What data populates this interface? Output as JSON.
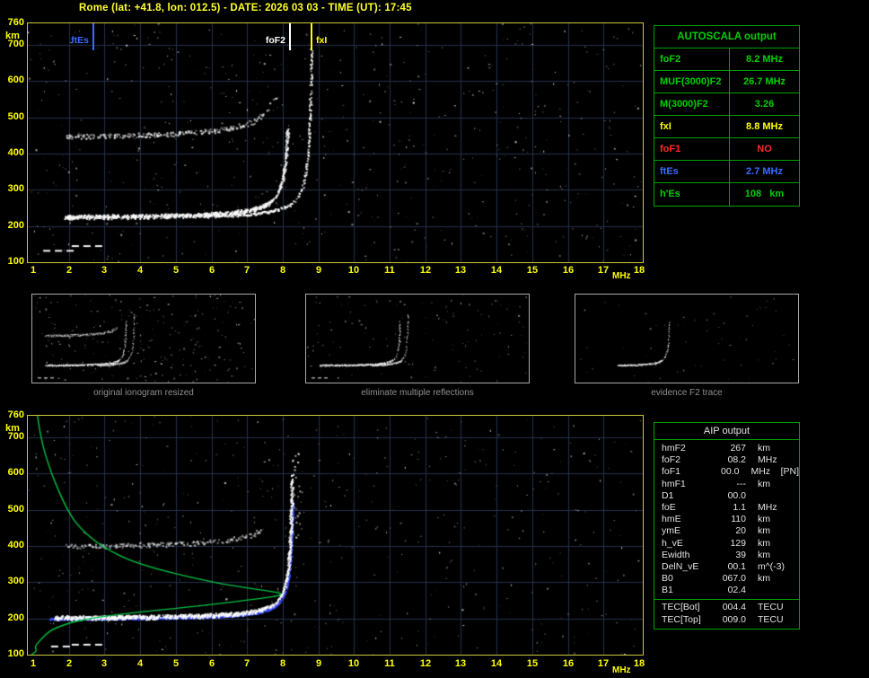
{
  "header": {
    "title": "Rome (lat: +41.8, lon: 012.5) - DATE: 2026 03 03 - TIME (UT): 17:45"
  },
  "colors": {
    "axis_yellow": "#ffff00",
    "plot_border": "#c9c93a",
    "grid": "#26304a",
    "table_green": "#00d000",
    "table_border": "#00a000",
    "red": "#ff2828",
    "blue": "#3a6bff",
    "yellow": "#ffff00",
    "white": "#ffffff",
    "aip_text": "#e2e2e2",
    "caption_gray": "#8f8f8f",
    "profile_green": "#00c244",
    "trace_blue": "#3d4fff"
  },
  "axes": {
    "x_unit": "MHz",
    "y_unit": "km",
    "x_ticks": [
      1,
      2,
      3,
      4,
      5,
      6,
      7,
      8,
      9,
      10,
      11,
      12,
      13,
      14,
      15,
      16,
      17,
      18
    ],
    "y_ticks": [
      760,
      700,
      600,
      500,
      400,
      300,
      200,
      100
    ]
  },
  "top_plot": {
    "markers": [
      {
        "label": "ftEs",
        "freq": 2.7,
        "color": "blue"
      },
      {
        "label": "foF2",
        "freq": 8.2,
        "color": "white"
      },
      {
        "label": "fxI",
        "freq": 8.8,
        "color": "yellow"
      }
    ]
  },
  "autoscala": {
    "title": "AUTOSCALA output",
    "rows": [
      {
        "param": "foF2",
        "value": "8.2 MHz",
        "color": "green"
      },
      {
        "param": "MUF(3000)F2",
        "value": "26.7 MHz",
        "color": "green"
      },
      {
        "param": "M(3000)F2",
        "value": "3.26",
        "color": "green"
      },
      {
        "param": "fxI",
        "value": "8.8 MHz",
        "color": "yellow"
      },
      {
        "param": "foF1",
        "value": "NO",
        "color": "red"
      },
      {
        "param": "ftEs",
        "value": "2.7 MHz",
        "color": "blue"
      },
      {
        "param": "h'Es",
        "value": "108   km",
        "color": "green"
      }
    ]
  },
  "thumbnails": [
    {
      "caption": "original ionogram resized"
    },
    {
      "caption": "eliminate multiple reflections"
    },
    {
      "caption": "evidence F2 trace"
    }
  ],
  "aip": {
    "title": "AIP output",
    "rows": [
      {
        "param": "hmF2",
        "value": "267",
        "unit": "km",
        "note": ""
      },
      {
        "param": "foF2",
        "value": "08.2",
        "unit": "MHz",
        "note": ""
      },
      {
        "param": "foF1",
        "value": "00.0",
        "unit": "MHz",
        "note": "[PN]"
      },
      {
        "param": "hmF1",
        "value": "---",
        "unit": "km",
        "note": ""
      },
      {
        "param": "D1",
        "value": "00.0",
        "unit": "",
        "note": ""
      },
      {
        "param": "foE",
        "value": "1.1",
        "unit": "MHz",
        "note": ""
      },
      {
        "param": "hmE",
        "value": "110",
        "unit": "km",
        "note": ""
      },
      {
        "param": "ymE",
        "value": "20",
        "unit": "km",
        "note": ""
      },
      {
        "param": "h_vE",
        "value": "129",
        "unit": "km",
        "note": ""
      },
      {
        "param": "Ewidth",
        "value": "39",
        "unit": "km",
        "note": ""
      },
      {
        "param": "DelN_vE",
        "value": "00.1",
        "unit": "m^(-3)",
        "note": ""
      },
      {
        "param": "B0",
        "value": "067.0",
        "unit": "km",
        "note": ""
      },
      {
        "param": "B1",
        "value": "02.4",
        "unit": "",
        "note": ""
      }
    ],
    "tec_rows": [
      {
        "param": "TEC[Bot]",
        "value": "004.4",
        "unit": "TECU",
        "note": ""
      },
      {
        "param": "TEC[Top]",
        "value": "009.0",
        "unit": "TECU",
        "note": ""
      }
    ]
  },
  "chart_data": [
    {
      "id": "top_ionogram",
      "type": "scatter",
      "x_label": "MHz",
      "y_label": "km",
      "x_range": [
        1,
        18
      ],
      "y_range": [
        100,
        760
      ],
      "grid": true,
      "foF2": 8.2,
      "fxI": 8.8,
      "ftEs": 2.7,
      "hEs": 108,
      "f2_flat_virtual_height": 228,
      "second_hop_flat_virtual_height": 448
    },
    {
      "id": "restored_ionogram_with_profile",
      "type": "scatter",
      "x_label": "MHz",
      "y_label": "km",
      "x_range": [
        1,
        18
      ],
      "y_range": [
        100,
        760
      ],
      "grid": true,
      "foF2": 8.2,
      "hmF2": 267,
      "f2_flat_virtual_height": 205,
      "profile_points": [
        [
          1.12,
          760
        ],
        [
          1.2,
          700
        ],
        [
          1.5,
          600
        ],
        [
          1.95,
          500
        ],
        [
          2.3,
          450
        ],
        [
          2.9,
          400
        ],
        [
          3.9,
          350
        ],
        [
          6.0,
          300
        ],
        [
          7.3,
          280
        ],
        [
          8.2,
          267
        ],
        [
          7.0,
          250
        ],
        [
          5.2,
          230
        ],
        [
          4.2,
          220
        ],
        [
          3.3,
          210
        ],
        [
          2.6,
          200
        ],
        [
          2.1,
          190
        ],
        [
          1.8,
          180
        ],
        [
          1.55,
          170
        ],
        [
          1.4,
          160
        ],
        [
          1.3,
          150
        ],
        [
          1.2,
          140
        ],
        [
          1.1,
          129
        ],
        [
          1.05,
          120
        ],
        [
          1.1,
          110
        ],
        [
          0.95,
          100
        ]
      ]
    }
  ]
}
